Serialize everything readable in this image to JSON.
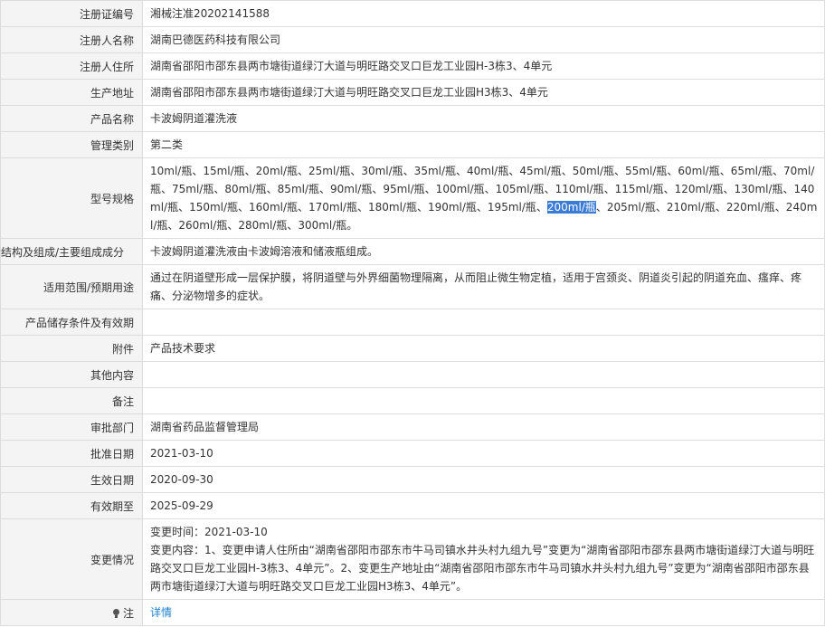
{
  "rows": {
    "reg_no": {
      "label": "注册证编号",
      "value": "湘械注准20202141588"
    },
    "registrant_name": {
      "label": "注册人名称",
      "value": "湖南巴德医药科技有限公司"
    },
    "registrant_address": {
      "label": "注册人住所",
      "value": "湖南省邵阳市邵东县两市塘街道绿汀大道与明旺路交叉口巨龙工业园H-3栋3、4单元"
    },
    "production_address": {
      "label": "生产地址",
      "value": "湖南省邵阳市邵东县两市塘街道绿汀大道与明旺路交叉口巨龙工业园H3栋3、4单元"
    },
    "product_name": {
      "label": "产品名称",
      "value": "卡波姆阴道灌洗液"
    },
    "management_class": {
      "label": "管理类别",
      "value": "第二类"
    },
    "model_spec": {
      "label": "型号规格",
      "before_highlight": "10ml/瓶、15ml/瓶、20ml/瓶、25ml/瓶、30ml/瓶、35ml/瓶、40ml/瓶、45ml/瓶、50ml/瓶、55ml/瓶、60ml/瓶、65ml/瓶、70ml/瓶、75ml/瓶、80ml/瓶、85ml/瓶、90ml/瓶、95ml/瓶、100ml/瓶、105ml/瓶、110ml/瓶、115ml/瓶、120ml/瓶、130ml/瓶、140ml/瓶、150ml/瓶、160ml/瓶、170ml/瓶、180ml/瓶、190ml/瓶、195ml/瓶、",
      "highlight": "200ml/瓶",
      "after_highlight": "、205ml/瓶、210ml/瓶、220ml/瓶、240ml/瓶、260ml/瓶、280ml/瓶、300ml/瓶。"
    },
    "structure": {
      "label": "结构及组成/主要组成成分",
      "value": "卡波姆阴道灌洗液由卡波姆溶液和储液瓶组成。"
    },
    "scope": {
      "label": "适用范围/预期用途",
      "value": "通过在阴道壁形成一层保护膜，将阴道壁与外界细菌物理隔离，从而阻止微生物定植，适用于宫颈炎、阴道炎引起的阴道充血、瘙痒、疼痛、分泌物增多的症状。"
    },
    "storage": {
      "label": "产品储存条件及有效期",
      "value": ""
    },
    "attachment": {
      "label": "附件",
      "value": "产品技术要求"
    },
    "other": {
      "label": "其他内容",
      "value": ""
    },
    "remarks": {
      "label": "备注",
      "value": ""
    },
    "approval_dept": {
      "label": "审批部门",
      "value": "湖南省药品监督管理局"
    },
    "approval_date": {
      "label": "批准日期",
      "value": "2021-03-10"
    },
    "effective_date": {
      "label": "生效日期",
      "value": "2020-09-30"
    },
    "valid_until": {
      "label": "有效期至",
      "value": "2025-09-29"
    },
    "changes": {
      "label": "变更情况",
      "time": "变更时间：2021-03-10",
      "content": "变更内容：1、变更申请人住所由“湖南省邵阳市邵东市牛马司镇水井头村九组九号”变更为“湖南省邵阳市邵东县两市塘街道绿汀大道与明旺路交叉口巨龙工业园H-3栋3、4单元”。2、变更生产地址由“湖南省邵阳市邵东市牛马司镇水井头村九组九号”变更为“湖南省邵阳市邵东县两市塘街道绿汀大道与明旺路交叉口巨龙工业园H3栋3、4单元”。"
    },
    "note": {
      "label": "注",
      "icon": "lightbulb-icon",
      "link": "详情"
    }
  },
  "colors": {
    "label_bg": "#f4f4f4",
    "border": "#dcdcdc",
    "link": "#1e7fd0",
    "highlight": "#3a7bd5"
  }
}
